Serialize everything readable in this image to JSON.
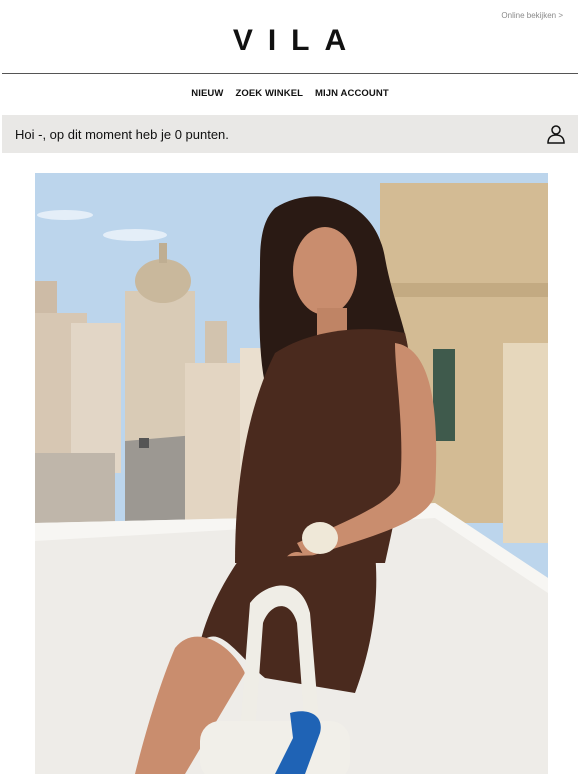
{
  "header": {
    "online_link": "Online bekijken >",
    "logo": "VILA"
  },
  "nav": {
    "items": [
      {
        "label": "NIEUW"
      },
      {
        "label": "ZOEK WINKEL"
      },
      {
        "label": "MIJN ACCOUNT"
      }
    ]
  },
  "points_bar": {
    "greeting": "Hoi -, op dit moment heb je 0 punten.",
    "icon": "user-icon"
  },
  "hero": {
    "icon": "photo"
  },
  "colors": {
    "background": "#ffffff",
    "points_bar": "#e9e8e6",
    "text": "#111111",
    "muted_link": "#8a8a8a"
  }
}
